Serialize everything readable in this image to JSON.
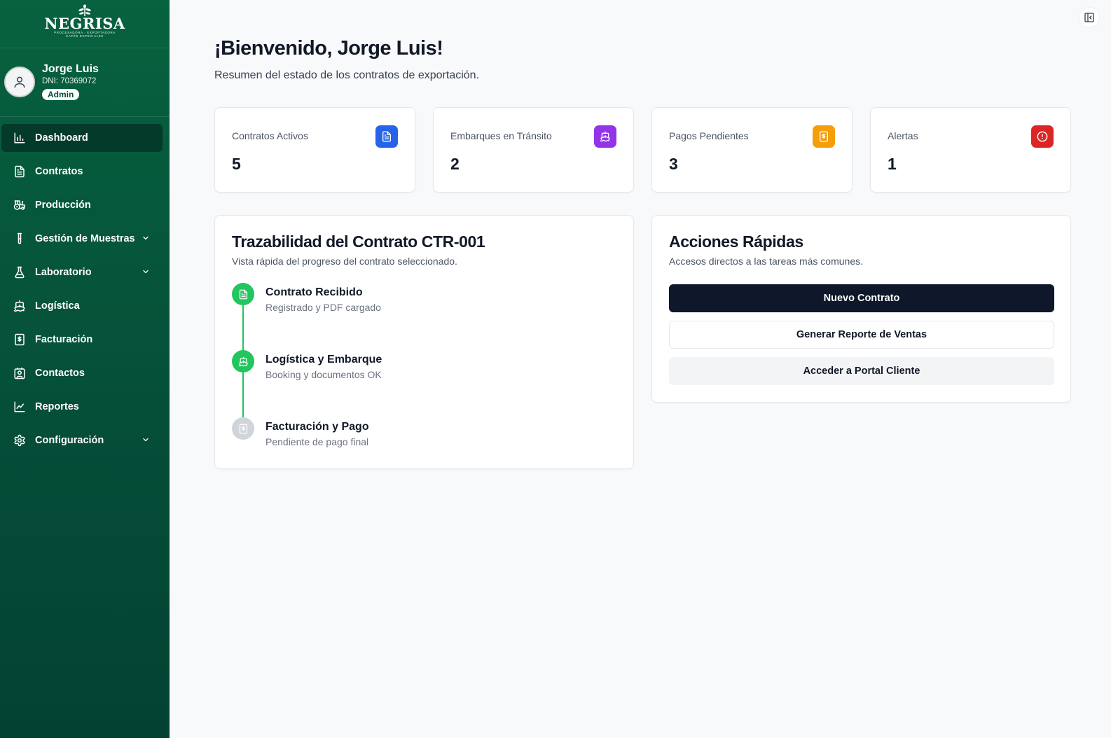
{
  "brand": {
    "name": "NEGRISA",
    "tagline_1": "PROCESADORA · EXPORTADORA",
    "tagline_2": "CAFÉS ESPECIALES"
  },
  "user": {
    "name": "Jorge Luis",
    "dni": "DNI: 70369072",
    "role": "Admin"
  },
  "nav": {
    "items": [
      {
        "label": "Dashboard",
        "icon": "bar-chart-icon",
        "active": true
      },
      {
        "label": "Contratos",
        "icon": "document-icon"
      },
      {
        "label": "Producción",
        "icon": "tractor-icon"
      },
      {
        "label": "Gestión de Muestras",
        "icon": "test-tube-icon",
        "expandable": true
      },
      {
        "label": "Laboratorio",
        "icon": "flask-icon",
        "expandable": true
      },
      {
        "label": "Logística",
        "icon": "ship-icon"
      },
      {
        "label": "Facturación",
        "icon": "invoice-icon"
      },
      {
        "label": "Contactos",
        "icon": "contact-icon"
      },
      {
        "label": "Reportes",
        "icon": "line-chart-icon"
      },
      {
        "label": "Configuración",
        "icon": "gear-icon",
        "expandable": true
      }
    ]
  },
  "header": {
    "title": "¡Bienvenido, Jorge Luis!",
    "subtitle": "Resumen del estado de los contratos de exportación."
  },
  "stats": [
    {
      "label": "Contratos Activos",
      "value": "5",
      "color": "#2563eb",
      "icon": "document-icon"
    },
    {
      "label": "Embarques en Tránsito",
      "value": "2",
      "color": "#9333ea",
      "icon": "ship-icon"
    },
    {
      "label": "Pagos Pendientes",
      "value": "3",
      "color": "#f59e0b",
      "icon": "invoice-icon"
    },
    {
      "label": "Alertas",
      "value": "1",
      "color": "#dc2626",
      "icon": "alert-icon"
    }
  ],
  "trace": {
    "title": "Trazabilidad del Contrato CTR-001",
    "description": "Vista rápida del progreso del contrato seleccionado.",
    "steps": [
      {
        "title": "Contrato Recibido",
        "subtitle": "Registrado y PDF cargado",
        "status": "done",
        "icon": "document-icon"
      },
      {
        "title": "Logística y Embarque",
        "subtitle": "Booking y documentos OK",
        "status": "done",
        "icon": "ship-icon"
      },
      {
        "title": "Facturación y Pago",
        "subtitle": "Pendiente de pago final",
        "status": "pending",
        "icon": "invoice-icon"
      }
    ]
  },
  "quick": {
    "title": "Acciones Rápidas",
    "description": "Accesos directos a las tareas más comunes.",
    "buttons": [
      {
        "label": "Nuevo Contrato"
      },
      {
        "label": "Generar Reporte de Ventas"
      },
      {
        "label": "Acceder a Portal Cliente"
      }
    ]
  },
  "colors": {
    "sidebar": "#054d38",
    "step_done": "#22c55e",
    "step_pending": "#d1d5db",
    "primary_button": "#0f172a"
  }
}
